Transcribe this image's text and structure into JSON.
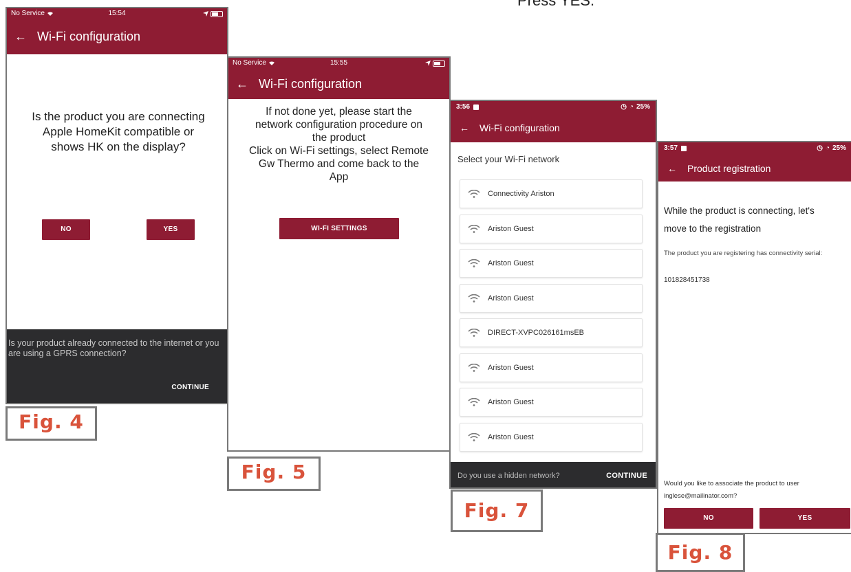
{
  "caption_top": "Press YES.",
  "screen4": {
    "status": {
      "carrier": "No Service",
      "time": "15:54"
    },
    "title": "Wi-Fi configuration",
    "question": "Is the product you are connecting Apple HomeKit compatible or shows HK on the display?",
    "no_label": "NO",
    "yes_label": "YES",
    "footer_text": "Is your product already connected to the internet or you are using a GPRS connection?",
    "continue_label": "CONTINUE",
    "fig_label": "Fig. 4"
  },
  "screen5": {
    "status": {
      "carrier": "No Service",
      "time": "15:55"
    },
    "title": "Wi-Fi configuration",
    "instructions": [
      "If not done yet, please start the",
      "network configuration procedure on",
      "the product",
      "Click on Wi-Fi settings, select Remote",
      "Gw Thermo and come back to the",
      "App"
    ],
    "button_label": "WI-FI SETTINGS",
    "fig_label": "Fig. 5"
  },
  "screen7": {
    "status": {
      "time": "3:56",
      "battery": "25%"
    },
    "title": "Wi-Fi configuration",
    "heading": "Select your Wi-Fi network",
    "networks": [
      "Connectivity Ariston",
      "Ariston Guest",
      "Ariston Guest",
      "Ariston Guest",
      "DIRECT-XVPC026161msEB",
      "Ariston Guest",
      "Ariston Guest",
      "Ariston Guest"
    ],
    "footer_text": "Do you use a hidden network?",
    "continue_label": "CONTINUE",
    "fig_label": "Fig. 7"
  },
  "screen8": {
    "status": {
      "time": "3:57",
      "battery": "25%"
    },
    "title": "Product registration",
    "heading_line1": "While the product is connecting, let's",
    "heading_line2": "move to the registration",
    "serial_intro": "The product you are registering has connectivity serial:",
    "serial": "101828451738",
    "assoc_line1": "Would you like to associate the product to user",
    "assoc_line2": "inglese@mailinator.com?",
    "no_label": "NO",
    "yes_label": "YES",
    "fig_label": "Fig. 8"
  },
  "colors": {
    "brand": "#8e1c33",
    "dark": "#2c2c2e",
    "fig": "#d9533b"
  }
}
